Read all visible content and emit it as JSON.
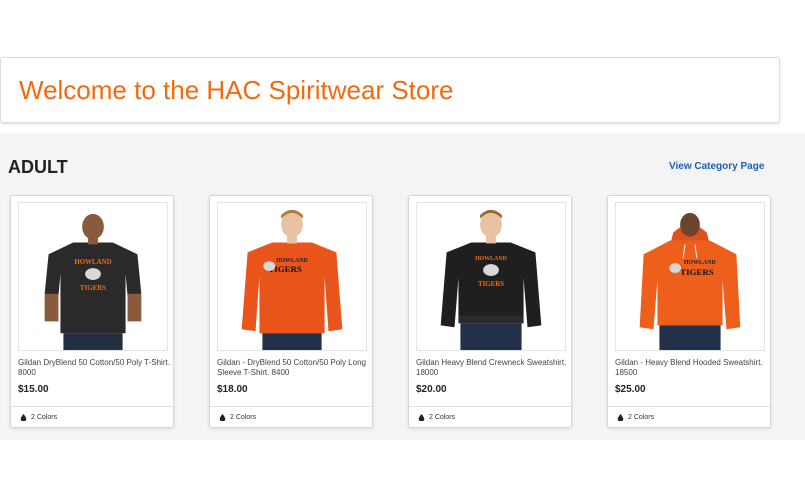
{
  "header": {
    "title": "Welcome to the HAC Spiritwear Store"
  },
  "section": {
    "title": "ADULT",
    "link_label": "View Category Page"
  },
  "products": [
    {
      "name": "Gildan DryBlend 50 Cotton/50 Poly T-Shirt. 8000",
      "price": "$15.00",
      "colors": "2 Colors",
      "shirt_color": "#2a2a2a",
      "style": "tshirt"
    },
    {
      "name": "Gildan - DryBlend 50 Cotton/50 Poly Long Sleeve T-Shirt. 8400",
      "price": "$18.00",
      "colors": "2 Colors",
      "shirt_color": "#e8541a",
      "style": "longsleeve"
    },
    {
      "name": "Gildan Heavy Blend Crewneck Sweatshirt. 18000",
      "price": "$20.00",
      "colors": "2 Colors",
      "shirt_color": "#1f1f1f",
      "style": "sweatshirt"
    },
    {
      "name": "Gildan - Heavy Blend Hooded Sweatshirt. 18500",
      "price": "$25.00",
      "colors": "2 Colors",
      "shirt_color": "#ee5f1c",
      "style": "hoodie"
    }
  ],
  "colors": {
    "accent": "#f26a10",
    "link": "#1a5fb4"
  }
}
